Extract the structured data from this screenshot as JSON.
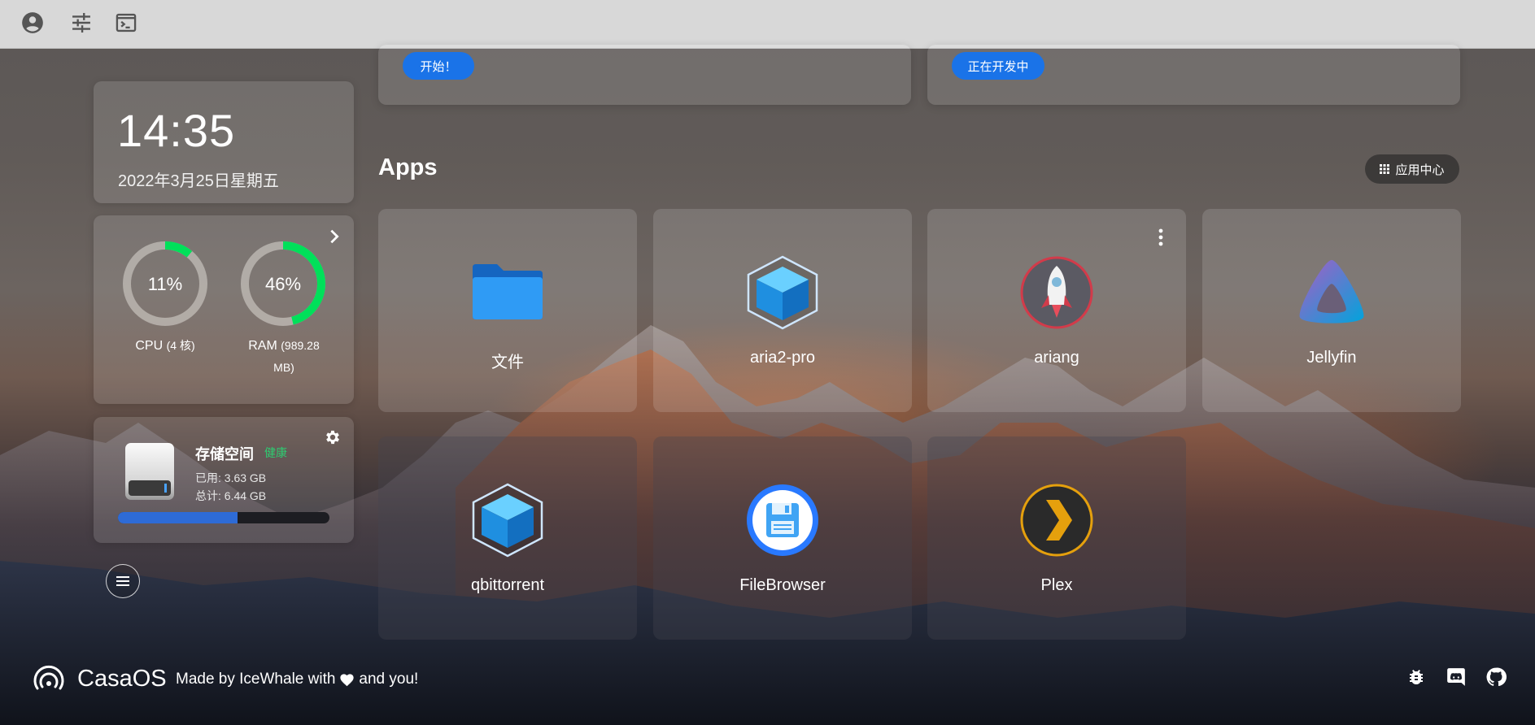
{
  "colors": {
    "accent": "#1a73e8",
    "gauge_green": "#00e05a",
    "healthy_green": "#2ecc71",
    "progress_blue": "#2e6bd6"
  },
  "topbar": {
    "icons": [
      "account-circle-icon",
      "tune-sliders-icon",
      "terminal-icon"
    ]
  },
  "top_cards": [
    {
      "button_label": "开始！"
    },
    {
      "button_label": "正在开发中"
    }
  ],
  "clock": {
    "time": "14:35",
    "date": "2022年3月25日星期五"
  },
  "system": {
    "cpu": {
      "percent": 11,
      "percent_label": "11%",
      "label": "CPU",
      "detail": "(4 核)"
    },
    "ram": {
      "percent": 46,
      "percent_label": "46%",
      "label": "RAM",
      "detail": "(989.28 MB)"
    }
  },
  "storage": {
    "title": "存储空间",
    "status": "健康",
    "used_label": "已用: 3.63 GB",
    "total_label": "总计: 6.44 GB",
    "used_fraction": 0.564
  },
  "apps_section": {
    "title": "Apps",
    "app_center_label": "应用中心"
  },
  "apps": [
    {
      "name": "文件",
      "icon": "folder-icon"
    },
    {
      "name": "aria2-pro",
      "icon": "cube-icon"
    },
    {
      "name": "ariang",
      "icon": "rocket-icon"
    },
    {
      "name": "Jellyfin",
      "icon": "jellyfin-icon"
    },
    {
      "name": "qbittorrent",
      "icon": "cube-icon"
    },
    {
      "name": "FileBrowser",
      "icon": "floppy-disk-icon"
    },
    {
      "name": "Plex",
      "icon": "plex-chevron-icon"
    }
  ],
  "footer": {
    "brand": "CasaOS",
    "tagline_prefix": "Made by IceWhale with",
    "tagline_suffix": "and you!",
    "icons": [
      "bug-icon",
      "discord-icon",
      "github-icon"
    ]
  }
}
